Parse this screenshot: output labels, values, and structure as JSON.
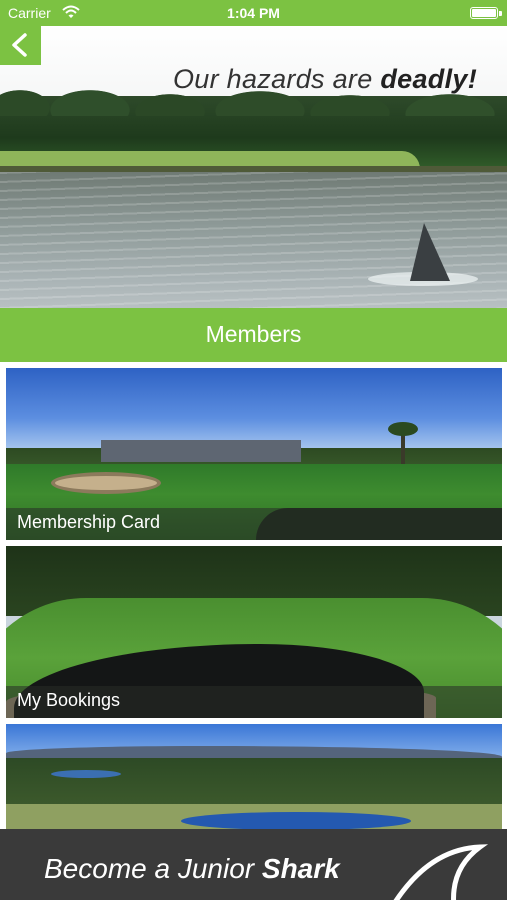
{
  "status_bar": {
    "carrier": "Carrier",
    "time": "1:04 PM",
    "battery_level": 1.0
  },
  "colors": {
    "accent": "#7cc242",
    "banner": "#3a3a3a"
  },
  "nav": {
    "back_icon": "chevron-left-icon"
  },
  "hero": {
    "tagline_prefix": "Our hazards are ",
    "tagline_emphasis": "deadly!"
  },
  "section": {
    "title": "Members"
  },
  "cards": [
    {
      "label": "Membership Card"
    },
    {
      "label": "My Bookings"
    },
    {
      "label": ""
    }
  ],
  "banner": {
    "text_prefix": "Become a Junior ",
    "text_emphasis": "Shark",
    "icon": "shark-fin-icon"
  }
}
